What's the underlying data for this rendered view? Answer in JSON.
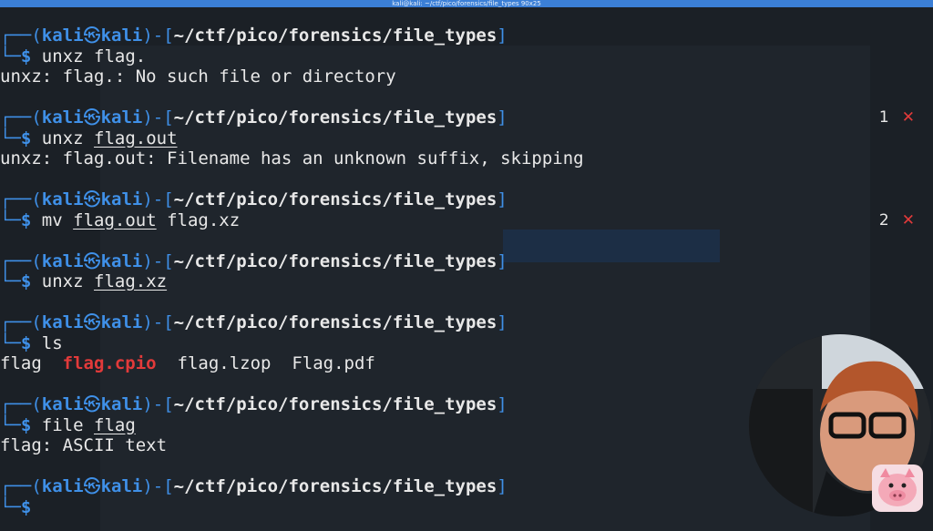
{
  "window": {
    "title": "kali@kali: ~/ctf/pico/forensics/file_types 90x25"
  },
  "prompt": {
    "open": "(",
    "user": "kali",
    "at": "㉿",
    "host": "kali",
    "close": ")-[",
    "path": "~/ctf/pico/forensics/file_types",
    "end": "]",
    "branch_top": "┌──",
    "branch_bottom": "└─",
    "dollar": "$"
  },
  "blocks": [
    {
      "cmd": "unxz",
      "arg": "flag.",
      "output": "unxz: flag.: No such file or directory"
    },
    {
      "cmd": "unxz",
      "arg": "flag.out",
      "output": "unxz: flag.out: Filename has an unknown suffix, skipping",
      "marker_num": "1",
      "marker_x": "✕"
    },
    {
      "cmd": "mv",
      "arg": "flag.out",
      "arg2": "flag.xz",
      "marker_num": "2",
      "marker_x": "✕"
    },
    {
      "cmd": "unxz",
      "arg": "flag.xz"
    },
    {
      "cmd": "ls",
      "ls_items": [
        "flag",
        "flag.cpio",
        "flag.lzop",
        "Flag.pdf"
      ]
    },
    {
      "cmd": "file",
      "arg": "flag",
      "output": "flag: ASCII text"
    },
    {
      "cmd": ""
    }
  ],
  "colors": {
    "prompt": "#3f90e8",
    "error": "#e23a3a",
    "archive": "#e23a3a",
    "text": "#e8e8e8"
  }
}
